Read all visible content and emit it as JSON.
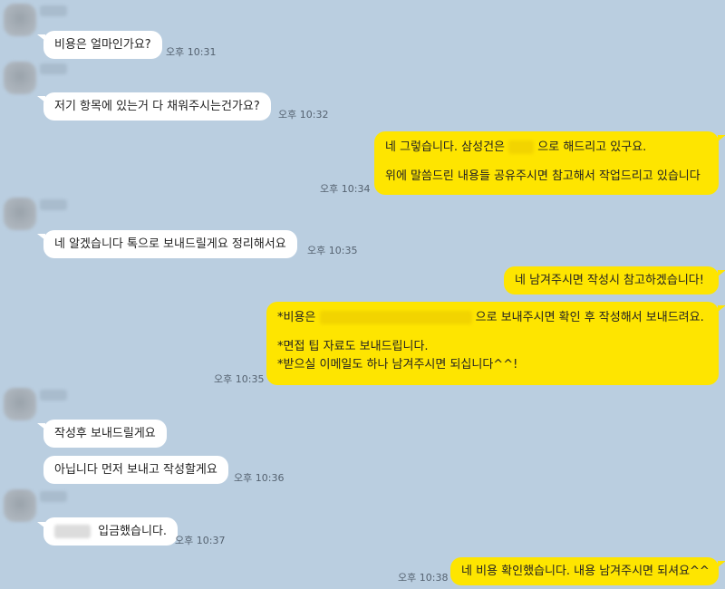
{
  "chat": {
    "m1": {
      "text": "비용은 얼마인가요?",
      "time": "오후 10:31"
    },
    "m2": {
      "text": "저기 항목에 있는거 다 채워주시는건가요?",
      "time": "오후 10:32"
    },
    "m3": {
      "line1_a": "네 그렇습니다. 삼성건은",
      "line1_b": "으로 해드리고 있구요.",
      "line2": "위에 말씀드린 내용들 공유주시면 참고해서 작업드리고 있습니다",
      "time": "오후 10:34"
    },
    "m4": {
      "text": "네 알겠습니다 톡으로 보내드릴게요 정리해서요",
      "time": "오후 10:35"
    },
    "m5": {
      "text": "네 남겨주시면 작성시 참고하겠습니다!"
    },
    "m6": {
      "line1_a": "*비용은",
      "line1_b": "으로 보내주시면 확인 후 작성해서 보내드려요.",
      "line2": "*면접 팁 자료도 보내드립니다.",
      "line3": "*받으실 이메일도 하나 남겨주시면 되십니다^^!",
      "time": "오후 10:35"
    },
    "m7": {
      "text": "작성후 보내드릴게요"
    },
    "m8": {
      "text": "아닙니다 먼저 보내고 작성할게요",
      "time": "오후 10:36"
    },
    "m9": {
      "text": "입금했습니다.",
      "time": "오후 10:37"
    },
    "m10": {
      "text": "네 비용 확인했습니다. 내용 남겨주시면 되셔요^^",
      "time": "오후 10:38"
    }
  },
  "colors": {
    "background": "#bacee0",
    "incoming_bubble": "#ffffff",
    "outgoing_bubble": "#fee500",
    "timestamp": "#556270"
  }
}
